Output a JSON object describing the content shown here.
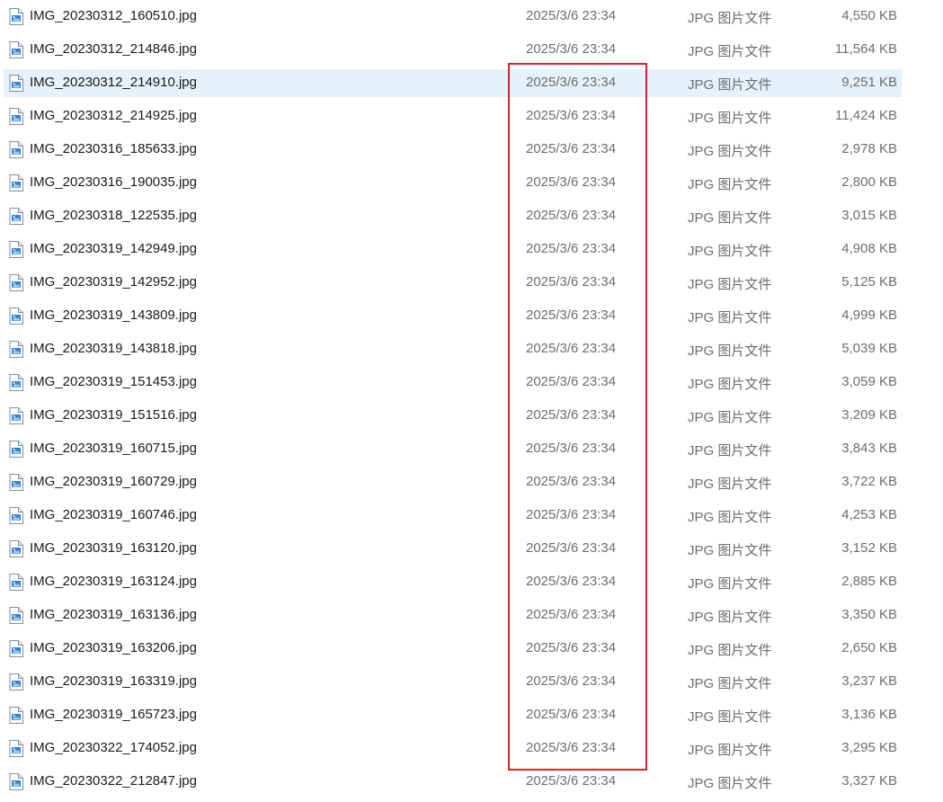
{
  "file_icon": "image-file-icon",
  "annotation_color": "#d8232a",
  "selection_color": "#e5f1fb",
  "files": [
    {
      "name": "IMG_20230312_160510.jpg",
      "date": "2025/3/6 23:34",
      "type": "JPG 图片文件",
      "size": "4,550 KB",
      "selected": false
    },
    {
      "name": "IMG_20230312_214846.jpg",
      "date": "2025/3/6 23:34",
      "type": "JPG 图片文件",
      "size": "11,564 KB",
      "selected": false
    },
    {
      "name": "IMG_20230312_214910.jpg",
      "date": "2025/3/6 23:34",
      "type": "JPG 图片文件",
      "size": "9,251 KB",
      "selected": true
    },
    {
      "name": "IMG_20230312_214925.jpg",
      "date": "2025/3/6 23:34",
      "type": "JPG 图片文件",
      "size": "11,424 KB",
      "selected": false
    },
    {
      "name": "IMG_20230316_185633.jpg",
      "date": "2025/3/6 23:34",
      "type": "JPG 图片文件",
      "size": "2,978 KB",
      "selected": false
    },
    {
      "name": "IMG_20230316_190035.jpg",
      "date": "2025/3/6 23:34",
      "type": "JPG 图片文件",
      "size": "2,800 KB",
      "selected": false
    },
    {
      "name": "IMG_20230318_122535.jpg",
      "date": "2025/3/6 23:34",
      "type": "JPG 图片文件",
      "size": "3,015 KB",
      "selected": false
    },
    {
      "name": "IMG_20230319_142949.jpg",
      "date": "2025/3/6 23:34",
      "type": "JPG 图片文件",
      "size": "4,908 KB",
      "selected": false
    },
    {
      "name": "IMG_20230319_142952.jpg",
      "date": "2025/3/6 23:34",
      "type": "JPG 图片文件",
      "size": "5,125 KB",
      "selected": false
    },
    {
      "name": "IMG_20230319_143809.jpg",
      "date": "2025/3/6 23:34",
      "type": "JPG 图片文件",
      "size": "4,999 KB",
      "selected": false
    },
    {
      "name": "IMG_20230319_143818.jpg",
      "date": "2025/3/6 23:34",
      "type": "JPG 图片文件",
      "size": "5,039 KB",
      "selected": false
    },
    {
      "name": "IMG_20230319_151453.jpg",
      "date": "2025/3/6 23:34",
      "type": "JPG 图片文件",
      "size": "3,059 KB",
      "selected": false
    },
    {
      "name": "IMG_20230319_151516.jpg",
      "date": "2025/3/6 23:34",
      "type": "JPG 图片文件",
      "size": "3,209 KB",
      "selected": false
    },
    {
      "name": "IMG_20230319_160715.jpg",
      "date": "2025/3/6 23:34",
      "type": "JPG 图片文件",
      "size": "3,843 KB",
      "selected": false
    },
    {
      "name": "IMG_20230319_160729.jpg",
      "date": "2025/3/6 23:34",
      "type": "JPG 图片文件",
      "size": "3,722 KB",
      "selected": false
    },
    {
      "name": "IMG_20230319_160746.jpg",
      "date": "2025/3/6 23:34",
      "type": "JPG 图片文件",
      "size": "4,253 KB",
      "selected": false
    },
    {
      "name": "IMG_20230319_163120.jpg",
      "date": "2025/3/6 23:34",
      "type": "JPG 图片文件",
      "size": "3,152 KB",
      "selected": false
    },
    {
      "name": "IMG_20230319_163124.jpg",
      "date": "2025/3/6 23:34",
      "type": "JPG 图片文件",
      "size": "2,885 KB",
      "selected": false
    },
    {
      "name": "IMG_20230319_163136.jpg",
      "date": "2025/3/6 23:34",
      "type": "JPG 图片文件",
      "size": "3,350 KB",
      "selected": false
    },
    {
      "name": "IMG_20230319_163206.jpg",
      "date": "2025/3/6 23:34",
      "type": "JPG 图片文件",
      "size": "2,650 KB",
      "selected": false
    },
    {
      "name": "IMG_20230319_163319.jpg",
      "date": "2025/3/6 23:34",
      "type": "JPG 图片文件",
      "size": "3,237 KB",
      "selected": false
    },
    {
      "name": "IMG_20230319_165723.jpg",
      "date": "2025/3/6 23:34",
      "type": "JPG 图片文件",
      "size": "3,136 KB",
      "selected": false
    },
    {
      "name": "IMG_20230322_174052.jpg",
      "date": "2025/3/6 23:34",
      "type": "JPG 图片文件",
      "size": "3,295 KB",
      "selected": false
    },
    {
      "name": "IMG_20230322_212847.jpg",
      "date": "2025/3/6 23:34",
      "type": "JPG 图片文件",
      "size": "3,327 KB",
      "selected": false
    }
  ]
}
